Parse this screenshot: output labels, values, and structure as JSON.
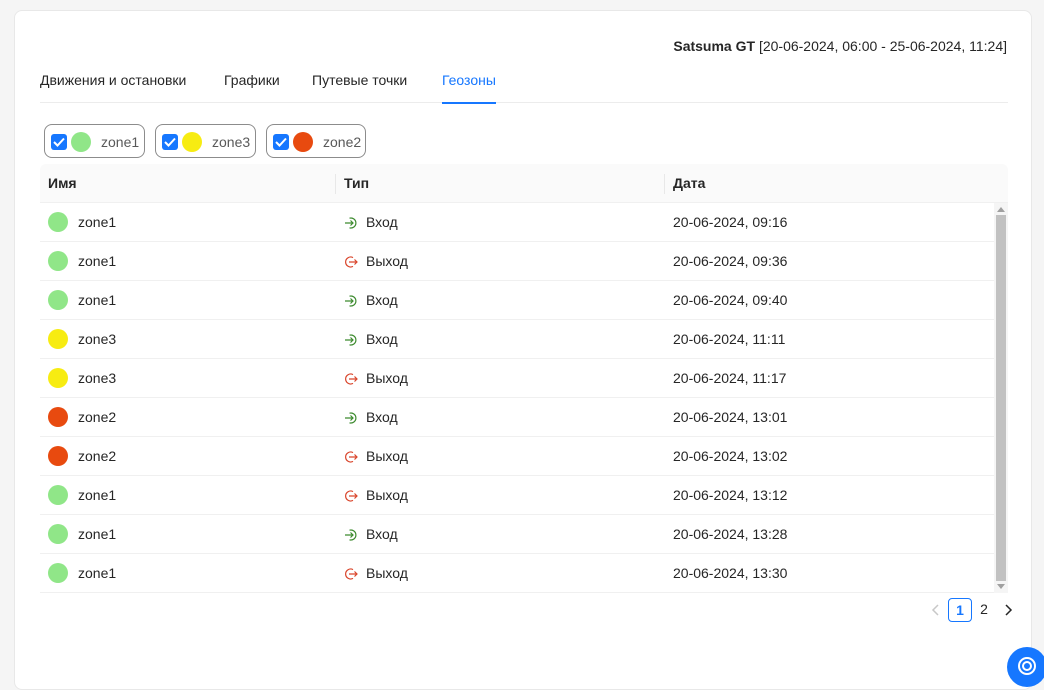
{
  "header": {
    "vehicle_name": "Satsuma GT",
    "period": "[20-06-2024, 06:00 - 25-06-2024, 11:24]"
  },
  "tabs": [
    {
      "label": "Движения и остановки",
      "active": false
    },
    {
      "label": "Графики",
      "active": false
    },
    {
      "label": "Путевые точки",
      "active": false
    },
    {
      "label": "Геозоны",
      "active": true
    }
  ],
  "filters": [
    {
      "label": "zone1",
      "color": "#90e688",
      "checked": true
    },
    {
      "label": "zone3",
      "color": "#f7ec12",
      "checked": true
    },
    {
      "label": "zone2",
      "color": "#e84a0f",
      "checked": true
    }
  ],
  "table": {
    "columns": {
      "name": "Имя",
      "type": "Тип",
      "date": "Дата"
    },
    "rows": [
      {
        "zone": "zone1",
        "color": "#90e688",
        "type": "Вход",
        "kind": "enter",
        "date": "20-06-2024, 09:16"
      },
      {
        "zone": "zone1",
        "color": "#90e688",
        "type": "Выход",
        "kind": "exit",
        "date": "20-06-2024, 09:36"
      },
      {
        "zone": "zone1",
        "color": "#90e688",
        "type": "Вход",
        "kind": "enter",
        "date": "20-06-2024, 09:40"
      },
      {
        "zone": "zone3",
        "color": "#f7ec12",
        "type": "Вход",
        "kind": "enter",
        "date": "20-06-2024, 11:11"
      },
      {
        "zone": "zone3",
        "color": "#f7ec12",
        "type": "Выход",
        "kind": "exit",
        "date": "20-06-2024, 11:17"
      },
      {
        "zone": "zone2",
        "color": "#e84a0f",
        "type": "Вход",
        "kind": "enter",
        "date": "20-06-2024, 13:01"
      },
      {
        "zone": "zone2",
        "color": "#e84a0f",
        "type": "Выход",
        "kind": "exit",
        "date": "20-06-2024, 13:02"
      },
      {
        "zone": "zone1",
        "color": "#90e688",
        "type": "Выход",
        "kind": "exit",
        "date": "20-06-2024, 13:12"
      },
      {
        "zone": "zone1",
        "color": "#90e688",
        "type": "Вход",
        "kind": "enter",
        "date": "20-06-2024, 13:28"
      },
      {
        "zone": "zone1",
        "color": "#90e688",
        "type": "Выход",
        "kind": "exit",
        "date": "20-06-2024, 13:30"
      }
    ]
  },
  "pagination": {
    "prev_icon": "chevron-left-icon",
    "next_icon": "chevron-right-icon",
    "pages": [
      "1",
      "2"
    ],
    "current": "1"
  },
  "icons": {
    "enter": "enter-arrow-icon",
    "exit": "exit-arrow-icon"
  },
  "colors": {
    "accent": "#1677ff",
    "enter": "#3c8a2e",
    "exit": "#d9442a"
  }
}
